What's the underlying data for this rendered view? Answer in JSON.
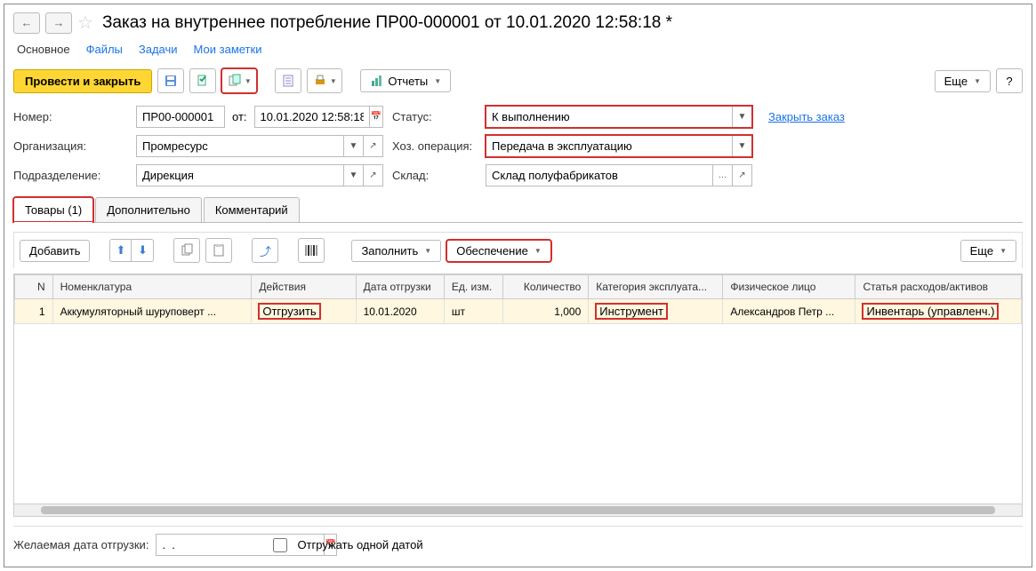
{
  "title": "Заказ на внутреннее потребление ПР00-000001 от 10.01.2020 12:58:18 *",
  "nav": {
    "main": "Основное",
    "files": "Файлы",
    "tasks": "Задачи",
    "notes": "Мои заметки"
  },
  "toolbar": {
    "primary": "Провести и закрыть",
    "reports": "Отчеты",
    "more": "Еще"
  },
  "fields": {
    "number_label": "Номер:",
    "number_value": "ПР00-000001",
    "from_label": "от:",
    "date_value": "10.01.2020 12:58:18",
    "status_label": "Статус:",
    "status_value": "К выполнению",
    "close_link": "Закрыть заказ",
    "org_label": "Организация:",
    "org_value": "Промресурс",
    "op_label": "Хоз. операция:",
    "op_value": "Передача в эксплуатацию",
    "dept_label": "Подразделение:",
    "dept_value": "Дирекция",
    "wh_label": "Склад:",
    "wh_value": "Склад полуфабрикатов"
  },
  "tabs": {
    "goods": "Товары (1)",
    "extra": "Дополнительно",
    "comment": "Комментарий"
  },
  "table_toolbar": {
    "add": "Добавить",
    "fill": "Заполнить",
    "supply": "Обеспечение",
    "more": "Еще"
  },
  "columns": {
    "n": "N",
    "nom": "Номенклатура",
    "act": "Действия",
    "date": "Дата отгрузки",
    "unit": "Ед. изм.",
    "qty": "Количество",
    "cat": "Категория эксплуата...",
    "person": "Физическое лицо",
    "article": "Статья расходов/активов"
  },
  "rows": [
    {
      "n": "1",
      "nom": "Аккумуляторный шуруповерт ...",
      "act": "Отгрузить",
      "date": "10.01.2020",
      "unit": "шт",
      "qty": "1,000",
      "cat": "Инструмент",
      "person": "Александров Петр ...",
      "article": "Инвентарь (управленч.)"
    }
  ],
  "bottom": {
    "date_label": "Желаемая дата отгрузки:",
    "date_value": ".  .",
    "single_date": "Отгружать одной датой"
  },
  "help": "?"
}
